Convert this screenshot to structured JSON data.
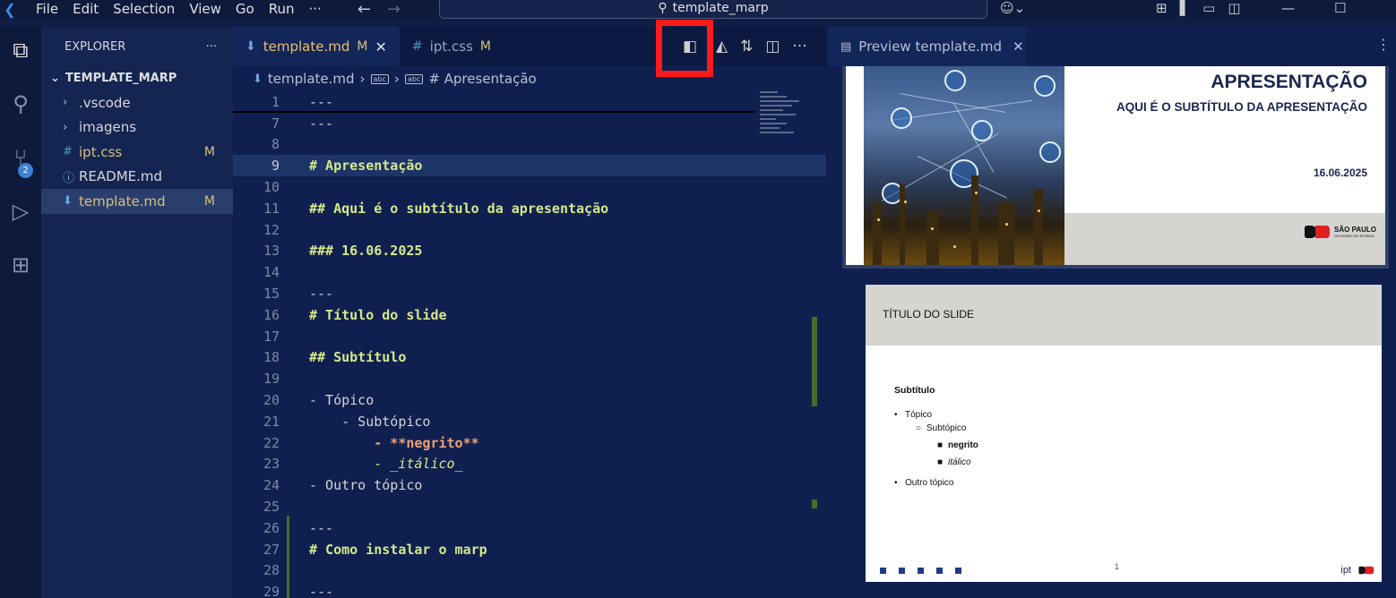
{
  "menu": [
    "File",
    "Edit",
    "Selection",
    "View",
    "Go",
    "Run",
    "···"
  ],
  "search": {
    "text": "template_marp"
  },
  "sidebar": {
    "header": "EXPLORER",
    "more": "···",
    "folder": "TEMPLATE_MARP",
    "items": [
      {
        "label": ".vscode",
        "icon": "chevron-right-icon",
        "mod": ""
      },
      {
        "label": "imagens",
        "icon": "chevron-right-icon",
        "mod": ""
      },
      {
        "label": "ipt.css",
        "icon": "css-hash-icon",
        "mod": "M"
      },
      {
        "label": "README.md",
        "icon": "info-icon",
        "mod": ""
      },
      {
        "label": "template.md",
        "icon": "markdown-icon",
        "mod": "M"
      }
    ],
    "scm_badge": "2"
  },
  "tabs": [
    {
      "label": "template.md",
      "mod": "M",
      "active": true
    },
    {
      "label": "ipt.css",
      "mod": "M",
      "active": false
    }
  ],
  "breadcrumb": {
    "file": "template.md",
    "symbol": "# Apresentação"
  },
  "code": {
    "lines": [
      {
        "n": "1",
        "text": "---"
      },
      {
        "n": "7",
        "text": "---"
      },
      {
        "n": "8",
        "text": ""
      },
      {
        "n": "9",
        "text": "# Apresentação"
      },
      {
        "n": "10",
        "text": ""
      },
      {
        "n": "11",
        "text": "## Aqui é o subtítulo da apresentação"
      },
      {
        "n": "12",
        "text": ""
      },
      {
        "n": "13",
        "text": "### 16.06.2025"
      },
      {
        "n": "14",
        "text": ""
      },
      {
        "n": "15",
        "text": "---"
      },
      {
        "n": "16",
        "text": "# Título do slide"
      },
      {
        "n": "17",
        "text": ""
      },
      {
        "n": "18",
        "text": "## Subtítulo"
      },
      {
        "n": "19",
        "text": ""
      },
      {
        "n": "20",
        "text": "- Tópico"
      },
      {
        "n": "21",
        "text": "    - Subtópico"
      },
      {
        "n": "22",
        "text": "        - **negrito**"
      },
      {
        "n": "23",
        "text": "        - _itálico_"
      },
      {
        "n": "24",
        "text": "- Outro tópico"
      },
      {
        "n": "25",
        "text": ""
      },
      {
        "n": "26",
        "text": "---"
      },
      {
        "n": "27",
        "text": "# Como instalar o marp"
      },
      {
        "n": "28",
        "text": ""
      },
      {
        "n": "29",
        "text": "---"
      }
    ]
  },
  "preview": {
    "tab_label": "Preview template.md",
    "slide1": {
      "title": "APRESENTAÇÃO",
      "subtitle": "AQUI É O SUBTÍTULO DA APRESENTAÇÃO",
      "date": "16.06.2025",
      "logo_text": "SÃO PAULO",
      "logo_small": "GOVERNO DO ESTADO"
    },
    "slide2": {
      "title": "TÍTULO DO SLIDE",
      "subtitle": "Subtítulo",
      "items": [
        {
          "level": 0,
          "text": "Tópico",
          "bullet": "•"
        },
        {
          "level": 1,
          "text": "Subtópico",
          "bullet": "○"
        },
        {
          "level": 2,
          "text": "negrito",
          "bullet": "■"
        },
        {
          "level": 2,
          "text": "itálico",
          "bullet": "■"
        },
        {
          "level": 0,
          "text": "Outro tópico",
          "bullet": "•"
        }
      ],
      "page": "1",
      "ipt": "ipt"
    }
  },
  "colors": {
    "highlight": "#ff1a1a",
    "accent": "#3b82d4",
    "modified": "#d7c179"
  }
}
